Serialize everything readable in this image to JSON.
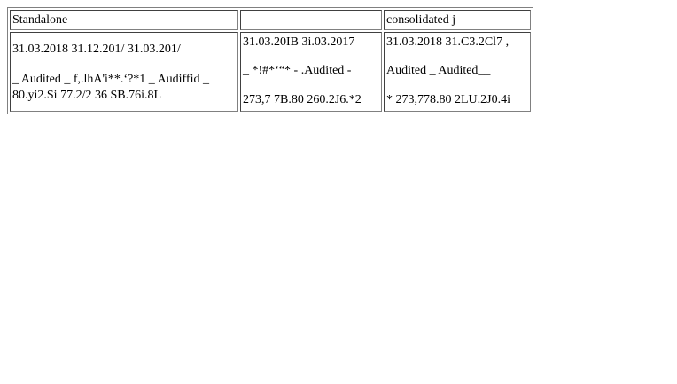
{
  "table": {
    "header": {
      "col1": "Standalone",
      "col2": "",
      "col3": "consolidated j"
    },
    "row": {
      "col1": {
        "line1": "31.03.2018 31.12.201/ 31.03.201/",
        "line2": "_ Audited _ f,.lhA'i**.‘?*1 _ Audiffid _",
        "line3": "80.yi2.Si 77.2/2 36 SB.76i.8L"
      },
      "col2": {
        "line1": "31.03.20IB 3i.03.2017",
        "line2": "_ *!#*‘“* - .Audited -",
        "line3": "273,7 7B.80 260.2J6.*2"
      },
      "col3": {
        "line1": "31.03.2018 31.C3.2Cl7 ,",
        "line2": "Audited _ Audited__",
        "line3": "* 273,778.80 2LU.2J0.4i"
      }
    }
  }
}
